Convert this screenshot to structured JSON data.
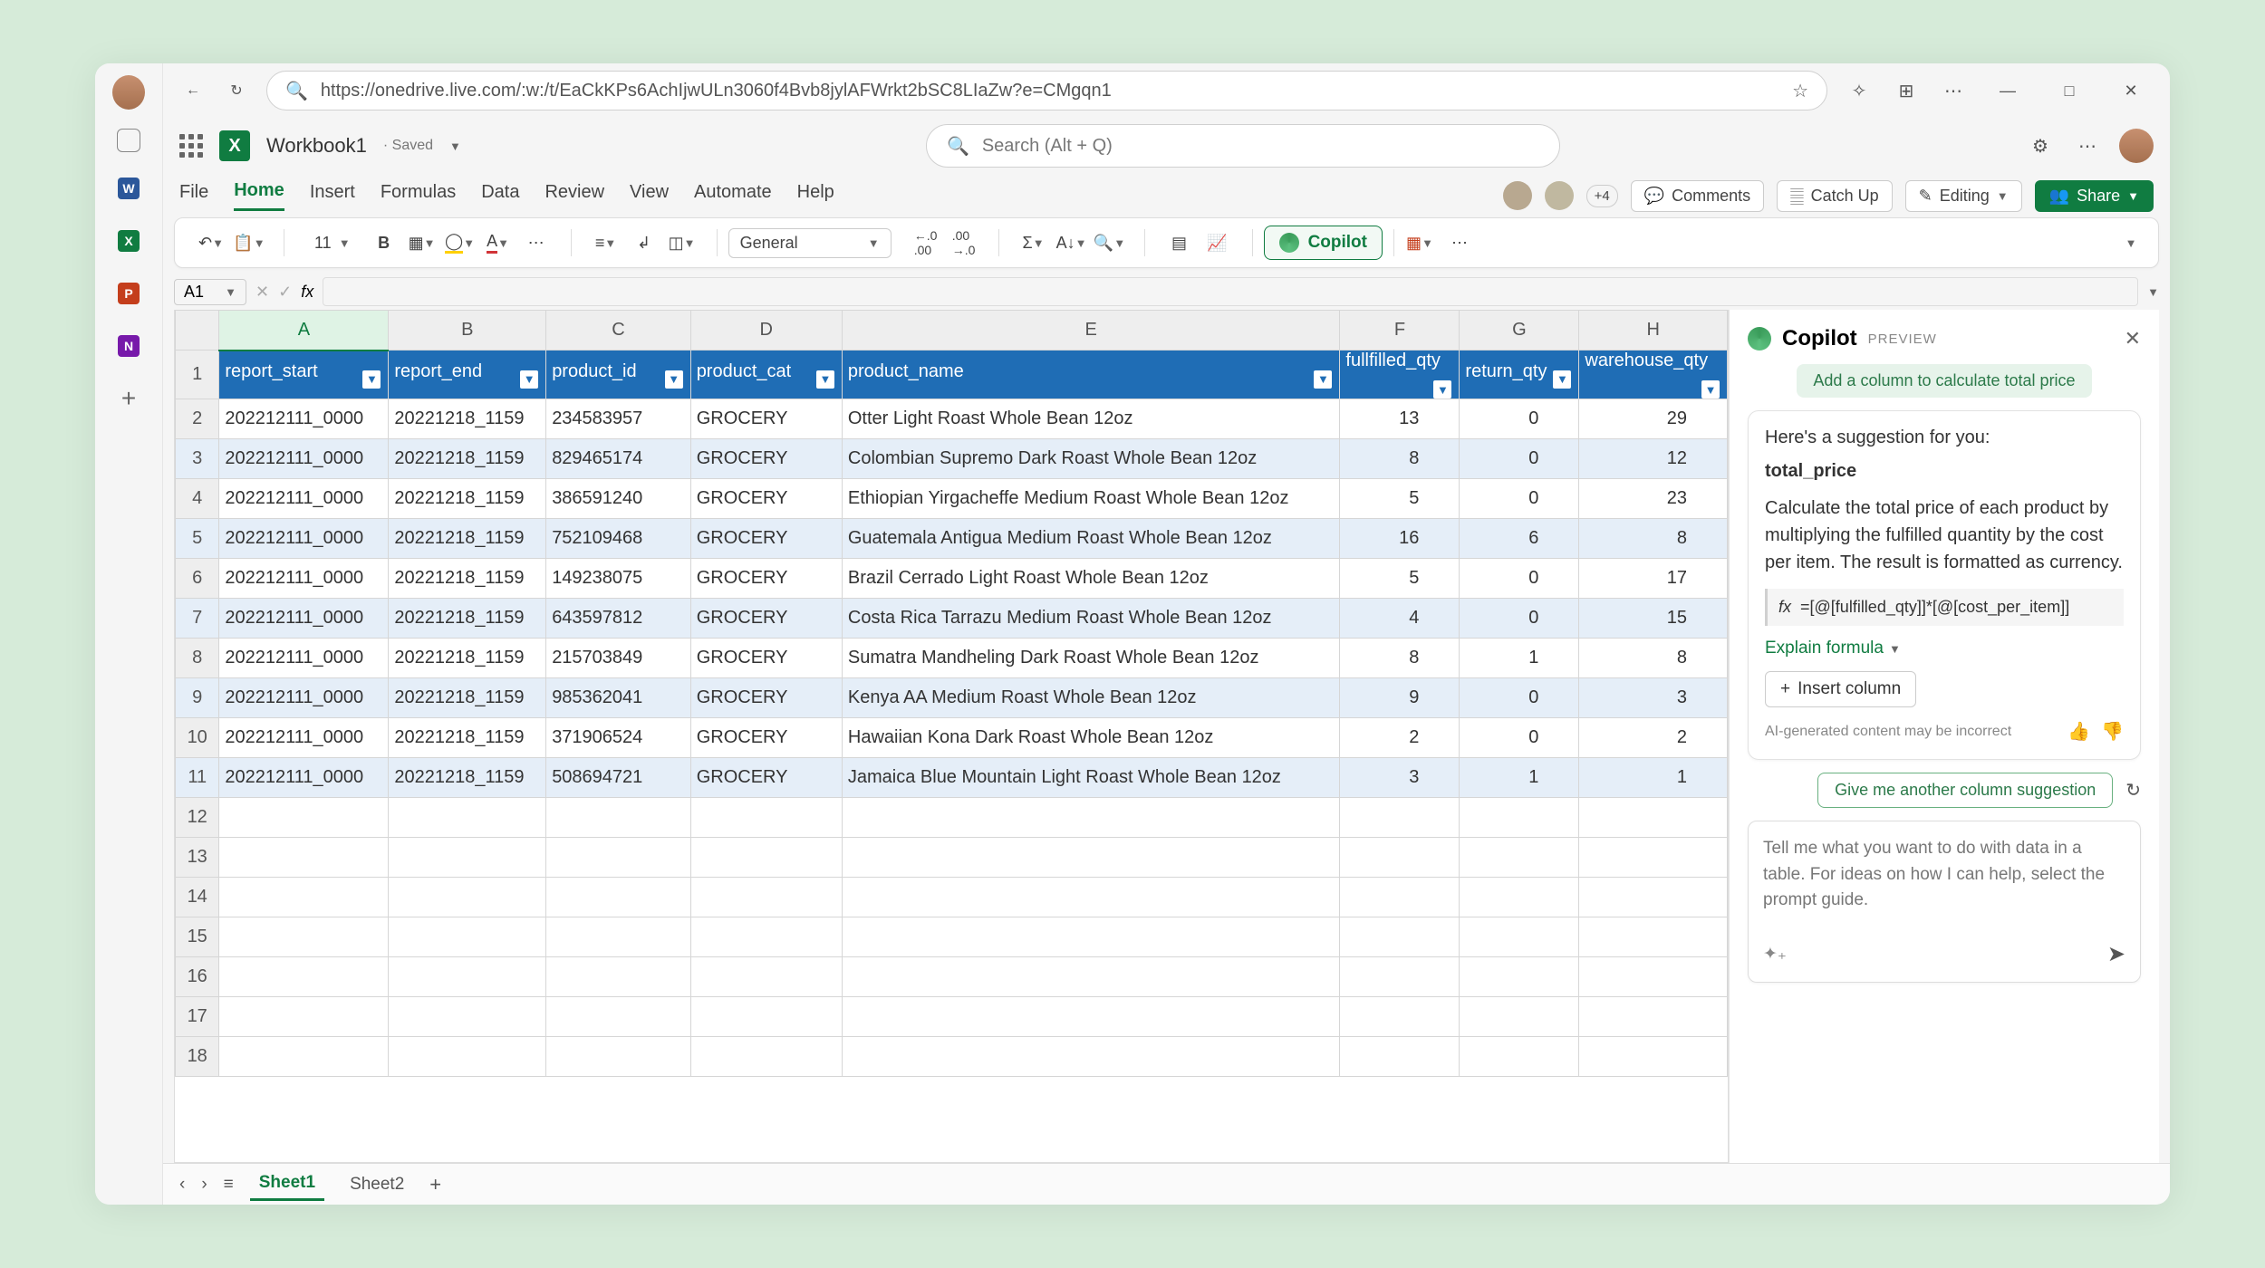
{
  "browser": {
    "url": "https://onedrive.live.com/:w:/t/EaCkKPs6AchIjwULn3060f4Bvb8jylAFWrkt2bSC8LIaZw?e=CMgqn1"
  },
  "doc": {
    "name": "Workbook1",
    "status": "· Saved"
  },
  "search": {
    "placeholder": "Search (Alt + Q)"
  },
  "ribbon_tabs": [
    "File",
    "Home",
    "Insert",
    "Formulas",
    "Data",
    "Review",
    "View",
    "Automate",
    "Help"
  ],
  "ribbon": {
    "plus_count": "+4",
    "comments": "Comments",
    "catch_up": "Catch Up",
    "editing": "Editing",
    "share": "Share"
  },
  "toolbar": {
    "font_size": "11",
    "number_format": "General",
    "copilot": "Copilot"
  },
  "name_box": "A1",
  "columns_letters": [
    "A",
    "B",
    "C",
    "D",
    "E",
    "F",
    "G",
    "H"
  ],
  "headers": [
    "report_start",
    "report_end",
    "product_id",
    "product_cat",
    "product_name",
    "fullfilled_qty",
    "return_qty",
    "warehouse_qty"
  ],
  "rows": [
    {
      "n": 2,
      "c": [
        "202212111_0000",
        "20221218_1159",
        "234583957",
        "GROCERY",
        "Otter Light Roast Whole Bean 12oz",
        "13",
        "0",
        "29"
      ]
    },
    {
      "n": 3,
      "c": [
        "202212111_0000",
        "20221218_1159",
        "829465174",
        "GROCERY",
        "Colombian Supremo Dark Roast Whole Bean 12oz",
        "8",
        "0",
        "12"
      ]
    },
    {
      "n": 4,
      "c": [
        "202212111_0000",
        "20221218_1159",
        "386591240",
        "GROCERY",
        "Ethiopian Yirgacheffe Medium Roast Whole Bean 12oz",
        "5",
        "0",
        "23"
      ]
    },
    {
      "n": 5,
      "c": [
        "202212111_0000",
        "20221218_1159",
        "752109468",
        "GROCERY",
        "Guatemala Antigua Medium Roast Whole Bean 12oz",
        "16",
        "6",
        "8"
      ]
    },
    {
      "n": 6,
      "c": [
        "202212111_0000",
        "20221218_1159",
        "149238075",
        "GROCERY",
        "Brazil Cerrado Light Roast Whole Bean 12oz",
        "5",
        "0",
        "17"
      ]
    },
    {
      "n": 7,
      "c": [
        "202212111_0000",
        "20221218_1159",
        "643597812",
        "GROCERY",
        "Costa Rica Tarrazu Medium Roast Whole Bean 12oz",
        "4",
        "0",
        "15"
      ]
    },
    {
      "n": 8,
      "c": [
        "202212111_0000",
        "20221218_1159",
        "215703849",
        "GROCERY",
        "Sumatra Mandheling Dark Roast Whole Bean 12oz",
        "8",
        "1",
        "8"
      ]
    },
    {
      "n": 9,
      "c": [
        "202212111_0000",
        "20221218_1159",
        "985362041",
        "GROCERY",
        "Kenya AA Medium Roast Whole Bean 12oz",
        "9",
        "0",
        "3"
      ]
    },
    {
      "n": 10,
      "c": [
        "202212111_0000",
        "20221218_1159",
        "371906524",
        "GROCERY",
        "Hawaiian Kona Dark Roast Whole Bean 12oz",
        "2",
        "0",
        "2"
      ]
    },
    {
      "n": 11,
      "c": [
        "202212111_0000",
        "20221218_1159",
        "508694721",
        "GROCERY",
        "Jamaica Blue Mountain Light Roast Whole Bean 12oz",
        "3",
        "1",
        "1"
      ]
    }
  ],
  "empty_rows": [
    12,
    13,
    14,
    15,
    16,
    17,
    18
  ],
  "sheet_tabs": [
    "Sheet1",
    "Sheet2"
  ],
  "copilot": {
    "title": "Copilot",
    "preview": "PREVIEW",
    "pill": "Add a column to calculate total price",
    "intro": "Here's a suggestion for you:",
    "colname": "total_price",
    "desc": "Calculate the total price of each product by multiplying the fulfilled quantity by the cost per item. The result is formatted as currency.",
    "formula": "=[@[fulfilled_qty]]*[@[cost_per_item]]",
    "explain": "Explain formula",
    "insert": "Insert column",
    "disclaimer": "AI-generated content may be incorrect",
    "another": "Give me another column suggestion",
    "prompt_placeholder": "Tell me what you want to do with data in a table. For ideas on how I can help, select the prompt guide."
  }
}
